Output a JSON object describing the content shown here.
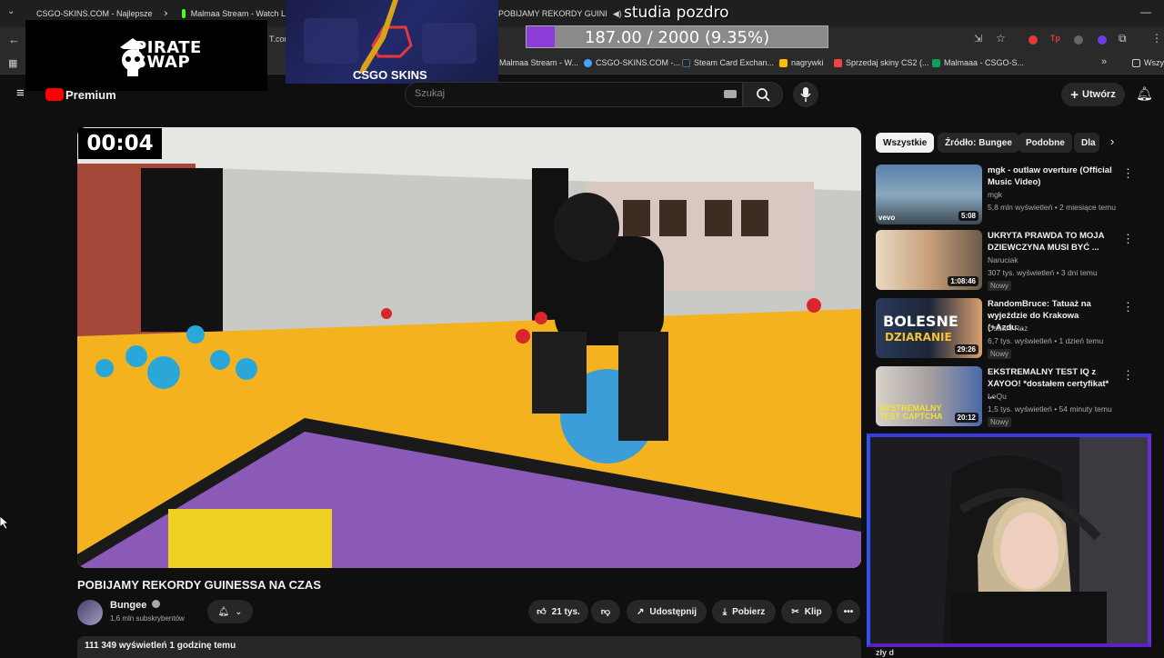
{
  "browser": {
    "tabs": [
      {
        "title": "CSGO-SKINS.COM - Najlepsze",
        "color": "#4aa3ff"
      },
      {
        "title": "Malmaa Stream - Watch Li",
        "color": "#53fc18"
      },
      {
        "title": "POBIJAMY REKORDY GUINI",
        "color": "#ff0000"
      }
    ],
    "url_partial": "T.com",
    "bookmarks": [
      {
        "label": "Malmaa Stream - W...",
        "color": "#53fc18"
      },
      {
        "label": "CSGO-SKINS.COM -...",
        "color": "#4aa3ff"
      },
      {
        "label": "Steam Card Exchan...",
        "color": "#1b2838"
      },
      {
        "label": "nagrywki",
        "color": "#fbbc04"
      },
      {
        "label": "Sprzedaj skiny CS2 (...",
        "color": "#e44"
      },
      {
        "label": "Malmaaa - CSGO-S...",
        "color": "#0f9d58"
      },
      {
        "label": "Wszy",
        "color": "#888"
      }
    ]
  },
  "overlay": {
    "sponsor1": "PIRATE SWAP",
    "sponsor2": "CSGO SKINS",
    "donation_text": "studia pozdro",
    "goal_text": "187.00 / 2000 (9.35%)",
    "goal_fraction": 0.0935
  },
  "youtube": {
    "logo_text": "Premium",
    "search_placeholder": "Szukaj",
    "create_label": "Utwórz"
  },
  "video": {
    "timer": "00:04",
    "title": "POBIJAMY REKORDY GUINESSA NA CZAS",
    "channel": "Bungee",
    "subscribers": "1,6 mln subskrybentów",
    "likes": "21 tys.",
    "share": "Udostępnij",
    "download": "Pobierz",
    "clip": "Klip",
    "views_time": "111 349 wyświetleń  1 godzinę temu"
  },
  "sidebar": {
    "chips": [
      "Wszystkie",
      "Źródło: Bungee",
      "Podobne",
      "Dla"
    ],
    "recommendations": [
      {
        "title": "mgk - outlaw overture (Official Music Video)",
        "channel": "mgk",
        "meta": "5,8 mln wyświetleń • 2 miesiące temu",
        "duration": "5:08",
        "badge": ""
      },
      {
        "title": "UKRYTA PRAWDA TO MOJA DZIEWCZYNA MUSI BYĆ ...",
        "channel": "Naruciak",
        "meta": "307 tys. wyświetleń • 3 dni temu",
        "duration": "1:08:46",
        "badge": "Nowy"
      },
      {
        "title": "RandomBruce: Tatuaż na wyjeździe do Krakowa (+Azdu...",
        "channel": "Ostatni Raz",
        "meta": "6,7 tys. wyświetleń • 1 dzień temu",
        "duration": "29:26",
        "badge": "Nowy"
      },
      {
        "title": "EKSTREMALNY TEST IQ z XAYOO! *dostałem certyfikat* ...",
        "channel": "LeQu",
        "meta": "1,5 tys. wyświetleń • 54 minuty temu",
        "duration": "20:12",
        "badge": "Nowy"
      }
    ],
    "next_partial": "zły d"
  }
}
